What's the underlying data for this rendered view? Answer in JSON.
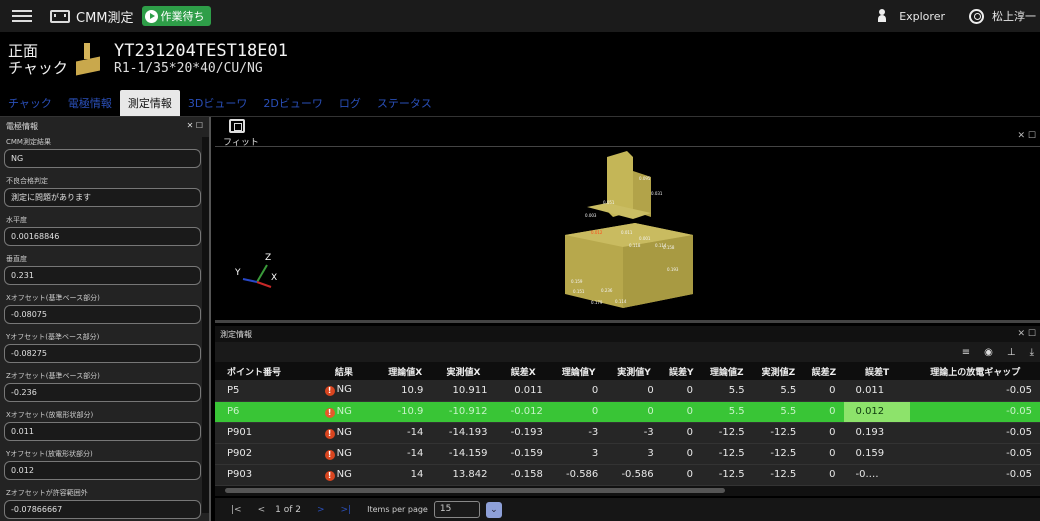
{
  "topbar": {
    "app_title": "CMM測定",
    "status": "作業待ち",
    "explorer": "Explorer",
    "user": "松上淳一"
  },
  "header": {
    "view_label": "正面",
    "view_sub": "チャック",
    "part_id": "YT231204TEST18E01",
    "part_spec": "R1-1/35*20*40/CU/NG"
  },
  "tabs": [
    "チャック",
    "電極情報",
    "測定情報",
    "3Dビューワ",
    "2Dビューワ",
    "ログ",
    "ステータス"
  ],
  "left_panel": {
    "title": "電極情報",
    "fields": [
      {
        "label": "CMM測定結果",
        "value": "NG"
      },
      {
        "label": "不良合格判定",
        "value": "測定に問題があります"
      },
      {
        "label": "水平度",
        "value": "0.00168846"
      },
      {
        "label": "垂直度",
        "value": "0.231"
      },
      {
        "label": "Xオフセット(基準ベース部分)",
        "value": "-0.08075"
      },
      {
        "label": "Yオフセット(基準ベース部分)",
        "value": "-0.08275"
      },
      {
        "label": "Zオフセット(基準ベース部分)",
        "value": "-0.236"
      },
      {
        "label": "Xオフセット(放電形状部分)",
        "value": "0.011"
      },
      {
        "label": "Yオフセット(放電形状部分)",
        "value": "0.012"
      },
      {
        "label": "Zオフセットが許容範囲外",
        "value": "-0.07866667"
      }
    ]
  },
  "viewer": {
    "fit_label": "フィット",
    "axes": {
      "x": "X",
      "y": "Y",
      "z": "Z"
    },
    "point_labels": [
      "0.095",
      "0.031",
      "0.051",
      "0.003",
      "0.012",
      "0.011",
      "0.001",
      "0.118",
      "0.114",
      "0.158",
      "0.193",
      "0.159",
      "0.236",
      "0.151",
      "0.179",
      "0.114"
    ]
  },
  "measure": {
    "title": "測定情報",
    "columns": [
      "ポイント番号",
      "結果",
      "理論値X",
      "実測値X",
      "誤差X",
      "理論値Y",
      "実測値Y",
      "誤差Y",
      "理論値Z",
      "実測値Z",
      "誤差Z",
      "誤差T",
      "理論上の放電ギャップ"
    ],
    "rows": [
      {
        "pt": "P5",
        "res": "NG",
        "tx": "10.9",
        "mx": "10.911",
        "ex": "0.011",
        "ty": "0",
        "my": "0",
        "ey": "0",
        "tz": "5.5",
        "mz": "5.5",
        "ez": "0",
        "et": "0.011",
        "gap": "-0.05"
      },
      {
        "pt": "P6",
        "res": "NG",
        "tx": "-10.9",
        "mx": "-10.912",
        "ex": "-0.012",
        "ty": "0",
        "my": "0",
        "ey": "0",
        "tz": "5.5",
        "mz": "5.5",
        "ez": "0",
        "et": "0.012",
        "gap": "-0.05"
      },
      {
        "pt": "P901",
        "res": "NG",
        "tx": "-14",
        "mx": "-14.193",
        "ex": "-0.193",
        "ty": "-3",
        "my": "-3",
        "ey": "0",
        "tz": "-12.5",
        "mz": "-12.5",
        "ez": "0",
        "et": "0.193",
        "gap": "-0.05"
      },
      {
        "pt": "P902",
        "res": "NG",
        "tx": "-14",
        "mx": "-14.159",
        "ex": "-0.159",
        "ty": "3",
        "my": "3",
        "ey": "0",
        "tz": "-12.5",
        "mz": "-12.5",
        "ez": "0",
        "et": "0.159",
        "gap": "-0.05"
      },
      {
        "pt": "P903",
        "res": "NG",
        "tx": "14",
        "mx": "13.842",
        "ex": "-0.158",
        "ty": "-0.586",
        "my": "-0.586",
        "ey": "0",
        "tz": "-12.5",
        "mz": "-12.5",
        "ez": "0",
        "et": "-0.…",
        "gap": "-0.05"
      }
    ]
  },
  "pager": {
    "count": "1 of 2",
    "items_per_page_label": "Items per page",
    "items_per_page": "15"
  }
}
